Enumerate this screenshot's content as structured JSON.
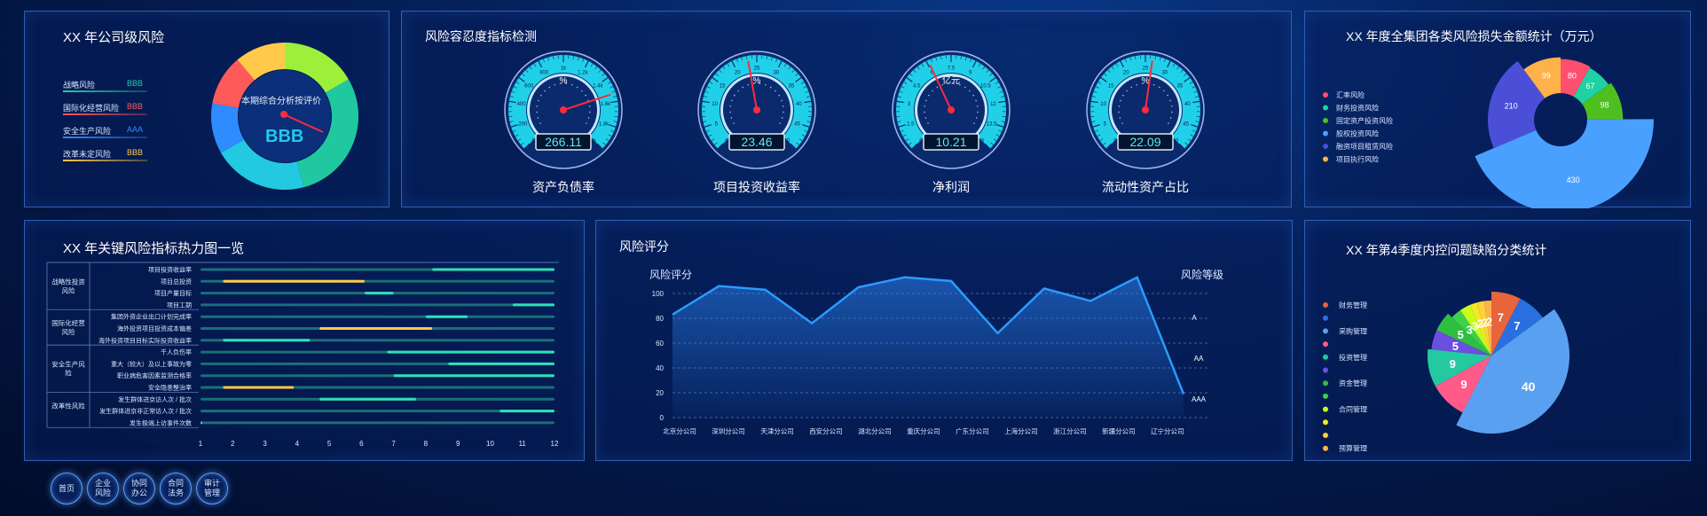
{
  "company_risk": {
    "title": "XX 年公司级风险",
    "legend": [
      {
        "name": "战略风险",
        "grade": "BBB",
        "color": "#1fd1a4",
        "grade_color": "#1fd1a4"
      },
      {
        "name": "国际化经营风险",
        "grade": "BBB",
        "color": "#ff5a5a",
        "grade_color": "#ff5a5a"
      },
      {
        "name": "安全生产风险",
        "grade": "AAA",
        "color": "#2f8cff",
        "grade_color": "#2f8cff"
      },
      {
        "name": "改革未定风险",
        "grade": "BBB",
        "color": "#ffc94a",
        "grade_color": "#ffc94a"
      }
    ],
    "center_label": "本期综合分析按评价",
    "center_grade": "BBB"
  },
  "tolerance": {
    "title": "风险容忍度指标检测",
    "gauges": [
      {
        "label": "资产负债率",
        "unit": "%",
        "value": "266.11",
        "ticks": [
          "0",
          "200",
          "400",
          "600",
          "800",
          "1k",
          "1.2k",
          "1.4k",
          "1.6k",
          "1.8k",
          "2k"
        ]
      },
      {
        "label": "项目投资收益率",
        "unit": "%",
        "value": "23.46",
        "ticks": [
          "0",
          "5",
          "10",
          "15",
          "20",
          "25",
          "30",
          "35",
          "40",
          "45",
          "50"
        ]
      },
      {
        "label": "净利润",
        "unit": "亿元",
        "value": "10.21",
        "ticks": [
          "0",
          "1.5",
          "3",
          "4.5",
          "6",
          "7.5",
          "9",
          "10.5",
          "12",
          "13.5",
          "15"
        ]
      },
      {
        "label": "流动性资产占比",
        "unit": "%",
        "value": "22.09",
        "ticks": [
          "0",
          "5",
          "10",
          "15",
          "20",
          "25",
          "30",
          "35",
          "40",
          "45",
          "50"
        ]
      }
    ]
  },
  "loss": {
    "title": "XX 年度全集团各类风险损失金额统计（万元）",
    "legend": [
      "汇率风险",
      "财务投资风险",
      "固定资产投资风险",
      "股权投资风险",
      "融资项目租赁风险",
      "项目执行风险"
    ]
  },
  "heatmap": {
    "title": "XX 年关键风险指标热力图一览",
    "groups": [
      {
        "name": "战略性投资风险",
        "rows": [
          "项目投资收益率",
          "项目总投资",
          "项目产量目标",
          "项目工期"
        ]
      },
      {
        "name": "国际化经营风险",
        "rows": [
          "集团外资企业出口计划完成率",
          "海外投资项目投资成本偏差",
          "海外投资项目目标实际投资收益率"
        ]
      },
      {
        "name": "安全生产风险",
        "rows": [
          "千人负伤率",
          "重大（较大）及以上事故为零",
          "职业病危害因素监测合格率",
          "安全隐患整治率"
        ]
      },
      {
        "name": "改革性风险",
        "rows": [
          "发生群体进京访人次 / 批次",
          "发生群体进京非正常访人次 / 批次",
          "发生极端上访事件次数"
        ]
      }
    ],
    "x_ticks": [
      "1",
      "2",
      "3",
      "4",
      "5",
      "6",
      "7",
      "8",
      "9",
      "10",
      "11",
      "12"
    ]
  },
  "score": {
    "title": "风险评分",
    "y_axis_label": "风险评分",
    "right_axis_label": "风险等级",
    "y_ticks": [
      "0",
      "20",
      "40",
      "60",
      "80",
      "100"
    ],
    "grade_labels": [
      "A",
      "AA",
      "AAA"
    ]
  },
  "defects": {
    "title": "XX 年第4季度内控问题缺陷分类统计",
    "legend": [
      "财务管理",
      "",
      "采购管理",
      "",
      "投资管理",
      "",
      "资金管理",
      "",
      "合同管理",
      "",
      "",
      "预算管理"
    ]
  },
  "nav": [
    {
      "label": "首页"
    },
    {
      "label": "企业风险"
    },
    {
      "label": "协同办公"
    },
    {
      "label": "合同法务"
    },
    {
      "label": "审计管理"
    }
  ],
  "chart_data": [
    {
      "type": "pie",
      "title": "XX 年度全集团各类风险损失金额统计（万元）",
      "categories": [
        "汇率风险",
        "财务投资风险",
        "固定资产投资风险",
        "股权投资风险",
        "融资项目租赁风险",
        "项目执行风险"
      ],
      "values": [
        80,
        67,
        98,
        430,
        210,
        99
      ],
      "colors": [
        "#ff4f6e",
        "#1fd1a4",
        "#4fbf20",
        "#4aa0ff",
        "#4b4fd8",
        "#ffb14a"
      ]
    },
    {
      "type": "line",
      "title": "风险评分",
      "ylabel": "风险评分",
      "categories": [
        "北京分公司",
        "深圳分公司",
        "天津分公司",
        "西安分公司",
        "湖北分公司",
        "重庆分公司",
        "广东分公司",
        "上海分公司",
        "浙江分公司",
        "新疆分公司",
        "辽宁分公司"
      ],
      "values": [
        83,
        106,
        103,
        76,
        105,
        113,
        110,
        68,
        104,
        94,
        113,
        19
      ],
      "ylim": [
        0,
        120
      ],
      "grid": true
    },
    {
      "type": "pie",
      "title": "XX 年第4季度内控问题缺陷分类统计",
      "values": [
        7,
        7,
        40,
        9,
        9,
        5,
        5,
        3,
        3,
        2,
        2,
        2
      ],
      "colors": [
        "#e8643a",
        "#2a6fe0",
        "#5aa0f0",
        "#ff5a8a",
        "#25c9a0",
        "#6a4fe0",
        "#2fbf40",
        "#3fd04a",
        "#c8ff1a",
        "#f5e826",
        "#ffd23a",
        "#ffb14a"
      ]
    },
    {
      "type": "heatmap",
      "title": "XX 年关键风险指标热力图一览",
      "x": [
        "1",
        "2",
        "3",
        "4",
        "5",
        "6",
        "7",
        "8",
        "9",
        "10",
        "11",
        "12"
      ],
      "bars": [
        {
          "row": "项目投资收益率",
          "segments": [
            {
              "from": 8.2,
              "to": 12,
              "level": "high"
            }
          ]
        },
        {
          "row": "项目总投资",
          "segments": [
            {
              "from": 1.7,
              "to": 6.1,
              "level": "warn"
            }
          ]
        },
        {
          "row": "项目产量目标",
          "segments": [
            {
              "from": 6.1,
              "to": 7.0,
              "level": "high"
            }
          ]
        },
        {
          "row": "项目工期",
          "segments": [
            {
              "from": 10.7,
              "to": 12,
              "level": "high"
            }
          ]
        },
        {
          "row": "集团外资企业出口计划完成率",
          "segments": [
            {
              "from": 8.0,
              "to": 9.3,
              "level": "high"
            }
          ]
        },
        {
          "row": "海外投资项目投资成本偏差",
          "segments": [
            {
              "from": 4.7,
              "to": 8.2,
              "level": "warn"
            }
          ]
        },
        {
          "row": "海外投资项目目标实际投资收益率",
          "segments": [
            {
              "from": 1.7,
              "to": 4.4,
              "level": "high"
            }
          ]
        },
        {
          "row": "千人负伤率",
          "segments": [
            {
              "from": 6.8,
              "to": 12,
              "level": "high"
            }
          ]
        },
        {
          "row": "重大（较大）及以上事故为零",
          "segments": [
            {
              "from": 8.7,
              "to": 12,
              "level": "high"
            }
          ]
        },
        {
          "row": "职业病危害因素监测合格率",
          "segments": [
            {
              "from": 7.0,
              "to": 12,
              "level": "high"
            }
          ]
        },
        {
          "row": "安全隐患整治率",
          "segments": [
            {
              "from": 1.7,
              "to": 3.9,
              "level": "warn"
            }
          ]
        },
        {
          "row": "发生群体进京访人次 / 批次",
          "segments": [
            {
              "from": 4.7,
              "to": 7.7,
              "level": "high"
            }
          ]
        },
        {
          "row": "发生群体进京非正常访人次 / 批次",
          "segments": [
            {
              "from": 10.3,
              "to": 12,
              "level": "high"
            }
          ]
        },
        {
          "row": "发生极端上访事件次数",
          "segments": [
            {
              "from": 1.0,
              "to": 1.0,
              "level": "high"
            }
          ]
        }
      ]
    }
  ]
}
